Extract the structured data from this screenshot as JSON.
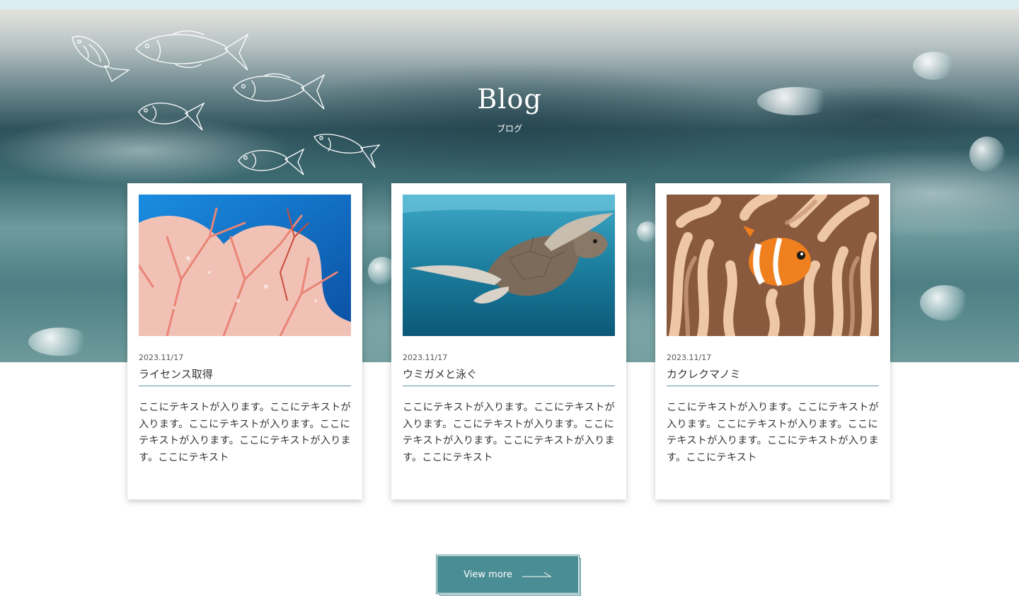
{
  "header": {
    "strip_color": "#dceef1"
  },
  "hero": {
    "title": "Blog",
    "subtitle": "ブログ",
    "decoration_icon": "fish-line-icon"
  },
  "posts": [
    {
      "date": "2023.11/17",
      "title": "ライセンス取得",
      "image": "coral-photo",
      "body": "ここにテキストが入ります。ここにテキストが入ります。ここにテキストが入ります。ここにテキストが入ります。ここにテキストが入ります。ここにテキスト"
    },
    {
      "date": "2023.11/17",
      "title": "ウミガメと泳ぐ",
      "image": "sea-turtle-photo",
      "body": "ここにテキストが入ります。ここにテキストが入ります。ここにテキストが入ります。ここにテキストが入ります。ここにテキストが入ります。ここにテキスト"
    },
    {
      "date": "2023.11/17",
      "title": "カクレクマノミ",
      "image": "clownfish-photo",
      "body": "ここにテキストが入ります。ここにテキストが入ります。ここにテキストが入ります。ここにテキストが入ります。ここにテキストが入ります。ここにテキスト"
    }
  ],
  "view_more": {
    "label": "View more",
    "icon": "arrow-right-icon",
    "color": "#4b8d94"
  },
  "colors": {
    "accent": "#4b8d94",
    "rule": "#5b969d"
  }
}
